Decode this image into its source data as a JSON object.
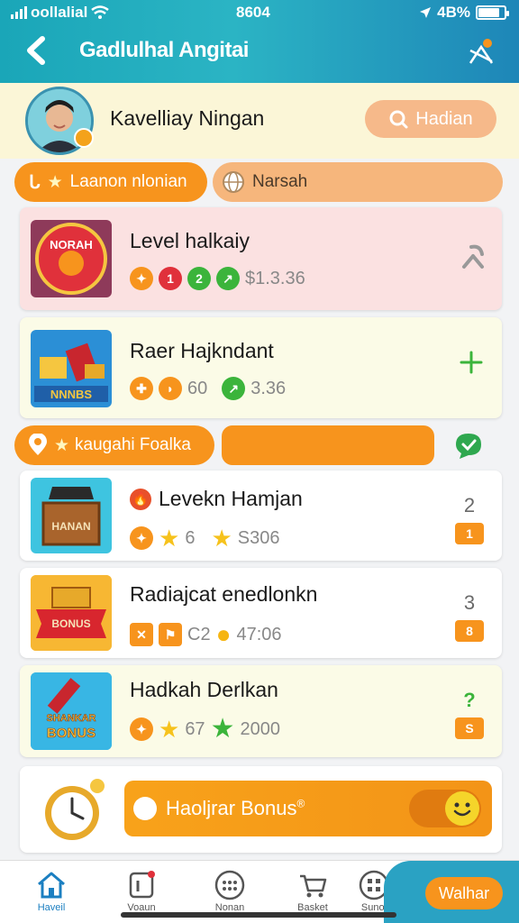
{
  "status_bar": {
    "carrier": "oollalial",
    "time": "8604",
    "battery_text": "4B%",
    "battery_level": 0.75
  },
  "header": {
    "title": "Gadlulhal Angitai",
    "back_icon": "back-chevron-icon",
    "action_icon": "map-pin-icon"
  },
  "profile": {
    "name": "Kavelliay Ningan",
    "action_label": "Hadian",
    "action_icon": "search-icon"
  },
  "tabs": [
    {
      "label": "Laanon nlonian",
      "icon": "star-icon"
    },
    {
      "label": "Narsah",
      "icon": "globe-icon"
    }
  ],
  "top_list": [
    {
      "title": "Level halkaiy",
      "stats": [
        "1",
        "2",
        "$1.3.36"
      ],
      "trailing_icon": "wrench-icon",
      "thumb_text": "NORAH"
    },
    {
      "title": "Raer Hajkndant",
      "stats": [
        "60",
        "3.36"
      ],
      "trailing_icon": "plus-icon",
      "thumb_text": "NNNBS"
    }
  ],
  "section2": {
    "label": "kaugahi Foalka",
    "icon": "location-star-icon",
    "chat_icon": "chat-bubble-icon"
  },
  "ranked_list": [
    {
      "title": "Levekn Hamjan",
      "stats": [
        "6",
        "S306"
      ],
      "rank": "2",
      "badge": "1",
      "thumb_text": "HANAN"
    },
    {
      "title": "Radiajcat enedlonkn",
      "stats": [
        "C2",
        "47:06"
      ],
      "rank": "3",
      "badge": "8",
      "thumb_text": "BONUS"
    },
    {
      "title": "Hadkah Derlkan",
      "stats": [
        "67",
        "2000"
      ],
      "rank": "?",
      "badge": "S",
      "thumb_text": "SHANKAR BONUS"
    }
  ],
  "bonus": {
    "label": "Haoljrar Bonus",
    "superscript": "®",
    "toggle_on": true
  },
  "bottom_nav": [
    {
      "label": "Haveil",
      "icon": "home-icon",
      "active": true
    },
    {
      "label": "Voaun",
      "icon": "badge-icon",
      "active": false
    },
    {
      "label": "Nonan",
      "icon": "grid-icon",
      "active": false
    },
    {
      "label": "Basket",
      "icon": "cart-icon",
      "active": false
    },
    {
      "label": "Sunoi",
      "icon": "apps-icon",
      "active": false
    }
  ],
  "nav_cta": {
    "label": "Walhar"
  },
  "colors": {
    "header": "#1aa6b8",
    "accent": "#f7941d",
    "green": "#3bb43b"
  }
}
